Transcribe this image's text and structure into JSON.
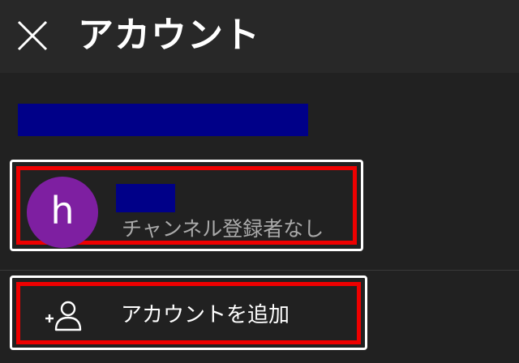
{
  "header": {
    "title": "アカウント",
    "close_icon": "close-icon"
  },
  "current_account": {
    "avatar_letter": "h",
    "avatar_color": "#7e1fa1",
    "subscriber_text": "チャンネル登録者なし"
  },
  "add_account": {
    "label": "アカウントを追加",
    "icon": "add-person-icon"
  },
  "colors": {
    "background": "#212121",
    "header": "#282828",
    "redaction": "#000088",
    "highlight": "#ee0000"
  }
}
